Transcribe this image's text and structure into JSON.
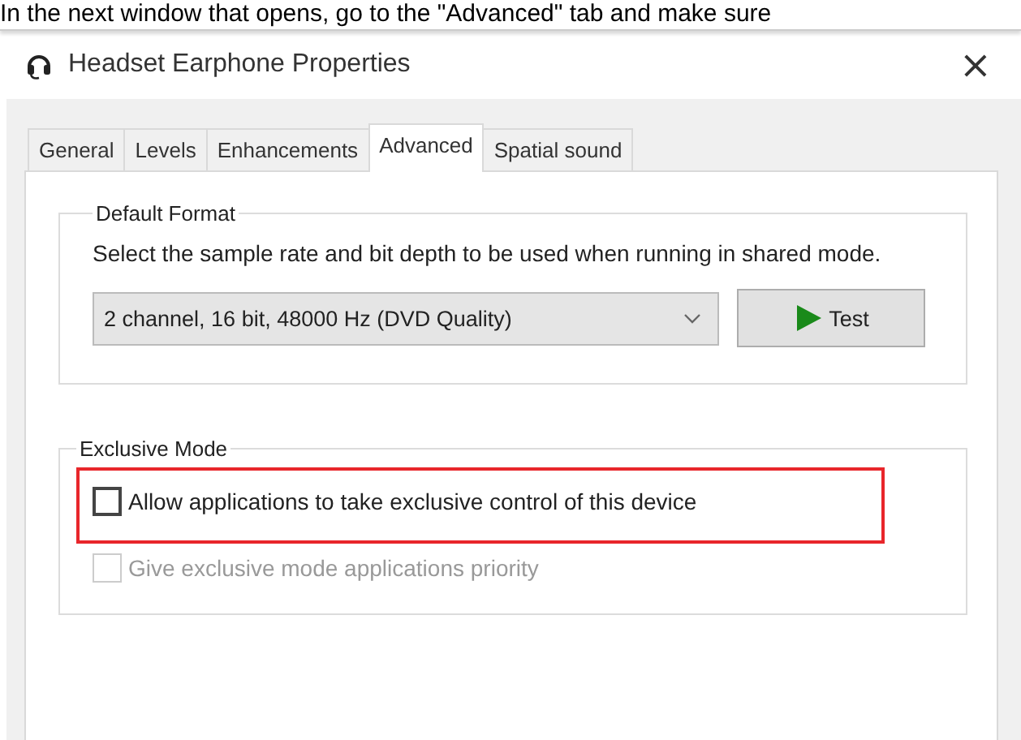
{
  "caption": "In the next window that opens, go to the \"Advanced\" tab and make sure",
  "window": {
    "title": "Headset Earphone Properties",
    "close": "×"
  },
  "tabs": [
    {
      "label": "General",
      "selected": false
    },
    {
      "label": "Levels",
      "selected": false
    },
    {
      "label": "Enhancements",
      "selected": false
    },
    {
      "label": "Advanced",
      "selected": true
    },
    {
      "label": "Spatial sound",
      "selected": false
    }
  ],
  "default_format": {
    "title": "Default Format",
    "description": "Select the sample rate and bit depth to be used when running in shared mode.",
    "format_select": {
      "value": "2 channel, 16 bit, 48000 Hz (DVD Quality)"
    },
    "test_button": "Test"
  },
  "exclusive_mode": {
    "title": "Exclusive Mode",
    "options": [
      {
        "label": "Allow applications to take exclusive control of this device",
        "checked": false,
        "disabled": false,
        "highlighted": true
      },
      {
        "label": "Give exclusive mode applications priority",
        "checked": false,
        "disabled": true,
        "highlighted": false
      }
    ]
  }
}
